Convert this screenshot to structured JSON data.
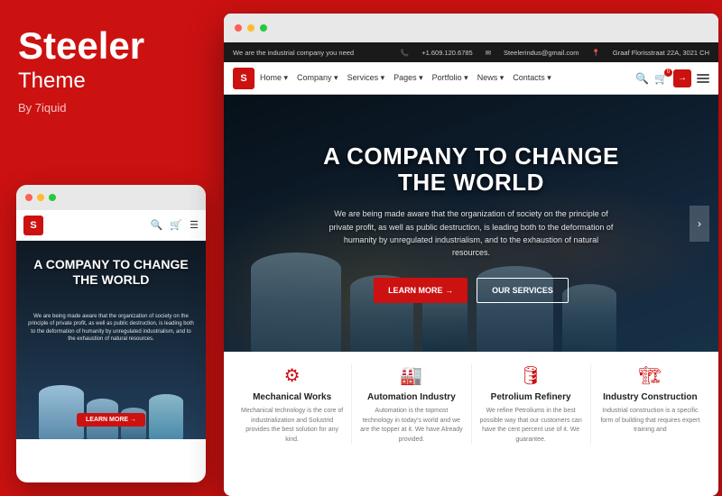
{
  "brand": {
    "title": "Steeler",
    "subtitle": "Theme",
    "by": "By 7iquid"
  },
  "mobile": {
    "hero_title": "A COMPANY TO CHANGE THE WORLD",
    "hero_body": "We are being made aware that the organization of society on the principle of private profit, as well as public destruction, is leading both to the deformation of humanity by unregulated industrialism, and to the exhaustion of natural resources.",
    "btn_label": "LEARN MORE →"
  },
  "browser": {
    "infobar": {
      "tagline": "We are the industrial company you need",
      "phone": "+1.609.120.6785",
      "email": "Steelerindus@gmail.com",
      "address": "Graaf Florisstraat 22A, 3021 CH"
    },
    "nav": {
      "logo": "S",
      "links": [
        "Home ▾",
        "Company ▾",
        "Services ▾",
        "Pages ▾",
        "Portfolio ▾",
        "News ▾",
        "Contacts ▾"
      ]
    },
    "hero": {
      "title": "A COMPANY TO CHANGE\nTHE WORLD",
      "body": "We are being made aware that the organization of society on the principle of private profit, as well as public destruction, is leading both to the deformation of humanity by unregulated industrialism, and to the exhaustion of natural resources.",
      "btn_primary": "LEARN MORE →",
      "btn_secondary": "OUR SERVICES"
    },
    "features": [
      {
        "icon": "⚙",
        "title": "Mechanical Works",
        "desc": "Mechanical technology is the core of industrialization and Solustrid provides the best solution for any kind."
      },
      {
        "icon": "🏭",
        "title": "Automation Industry",
        "desc": "Automation is the topmost technology in today's world and we are the topper at it. We have Already provided."
      },
      {
        "icon": "🛢",
        "title": "Petrolium Refinery",
        "desc": "We refine Petroliums in the best possible way that our customers can have the cent percent use of it. We guarantee."
      },
      {
        "icon": "🏗",
        "title": "Industry Construction",
        "desc": "Industrial construction is a specific form of building that requires expert training and"
      }
    ]
  },
  "colors": {
    "red": "#cc1111",
    "dark": "#1a1a1a",
    "white": "#ffffff"
  }
}
